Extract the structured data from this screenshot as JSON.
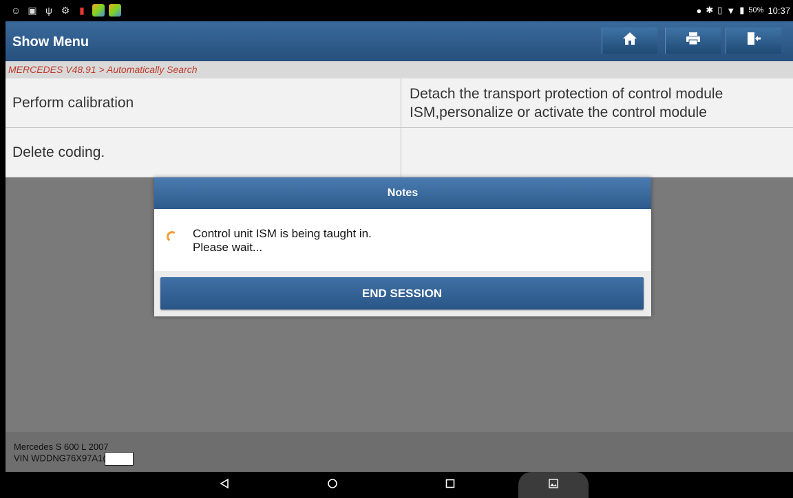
{
  "status_bar": {
    "left_icons": [
      "wechat-icon",
      "gallery-icon",
      "usb-debug-icon",
      "settings-gear-icon",
      "battery-saver-icon",
      "app-launcher-icon",
      "app-launcher-icon"
    ],
    "right_icons": [
      "location-icon",
      "bluetooth-icon",
      "vibrate-icon",
      "wifi-icon",
      "battery-icon"
    ],
    "battery": "50%",
    "time": "10:37"
  },
  "header": {
    "title": "Show Menu",
    "buttons": [
      "home-icon",
      "print-icon",
      "exit-icon"
    ]
  },
  "breadcrumb": "MERCEDES V48.91 > Automatically Search",
  "menu": {
    "rows": [
      {
        "left": "Perform calibration",
        "right": "Detach the transport protection of control module ISM,personalize or activate the control module"
      },
      {
        "left": "Delete coding.",
        "right": ""
      }
    ]
  },
  "dialog": {
    "title": "Notes",
    "message_line1": "Control unit ISM is being taught in.",
    "message_line2": "Please wait...",
    "button": "END SESSION"
  },
  "footer": {
    "vehicle": "Mercedes S 600 L 2007",
    "vin": "VIN WDDNG76X97A1("
  },
  "nav_bar": [
    "back-icon",
    "home-circle-icon",
    "recents-icon",
    "screenshot-icon"
  ],
  "colors": {
    "header_blue": "#2d5a8c",
    "breadcrumb_red": "#c0392b",
    "spinner_orange": "#f39c35"
  }
}
